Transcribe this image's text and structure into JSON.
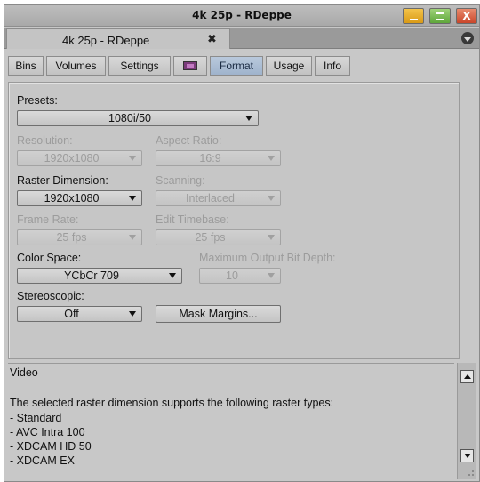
{
  "window": {
    "title": "4k 25p - RDeppe"
  },
  "document_tab": {
    "label": "4k 25p - RDeppe",
    "close_glyph": "✖"
  },
  "tabs": [
    {
      "label": "Bins",
      "active": false
    },
    {
      "label": "Volumes",
      "active": false
    },
    {
      "label": "Settings",
      "active": false
    },
    {
      "label": "",
      "icon": "color-swatch-icon",
      "active": false
    },
    {
      "label": "Format",
      "active": true
    },
    {
      "label": "Usage",
      "active": false
    },
    {
      "label": "Info",
      "active": false
    }
  ],
  "format": {
    "presets": {
      "label": "Presets:",
      "value": "1080i/50",
      "enabled": true
    },
    "resolution": {
      "label": "Resolution:",
      "value": "1920x1080",
      "enabled": false
    },
    "aspect_ratio": {
      "label": "Aspect Ratio:",
      "value": "16:9",
      "enabled": false
    },
    "raster_dimension": {
      "label": "Raster Dimension:",
      "value": "1920x1080",
      "enabled": true
    },
    "scanning": {
      "label": "Scanning:",
      "value": "Interlaced",
      "enabled": false
    },
    "frame_rate": {
      "label": "Frame Rate:",
      "value": "25 fps",
      "enabled": false
    },
    "edit_timebase": {
      "label": "Edit Timebase:",
      "value": "25 fps",
      "enabled": false
    },
    "color_space": {
      "label": "Color Space:",
      "value": "YCbCr 709",
      "enabled": true
    },
    "max_bit_depth": {
      "label": "Maximum Output Bit Depth:",
      "value": "10",
      "enabled": false
    },
    "stereoscopic": {
      "label": "Stereoscopic:",
      "value": "Off",
      "enabled": true
    },
    "mask_margins": {
      "label": "Mask Margins..."
    }
  },
  "description": {
    "lines": [
      "Video",
      "",
      "The selected raster dimension supports the following raster types:",
      " - Standard",
      " - AVC Intra 100",
      " - XDCAM HD 50",
      " - XDCAM EX"
    ]
  },
  "colors": {
    "window_bg": "#c8c8c8",
    "active_tab": "#a6b8cf",
    "minimize_button": "#e5ad2a",
    "maximize_button": "#74b84c",
    "close_button": "#d65a3b"
  }
}
